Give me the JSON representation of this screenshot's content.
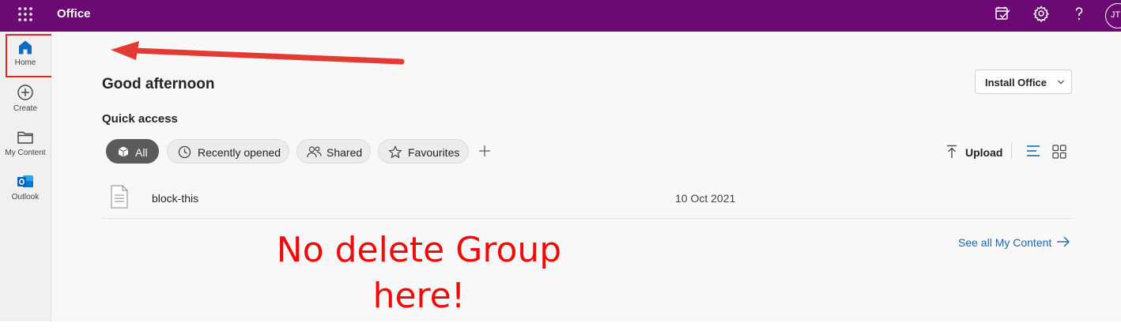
{
  "topbar": {
    "app_name": "Office",
    "avatar_initials": "JT",
    "icons": [
      "waffle-icon",
      "feedback-icon",
      "settings-icon",
      "help-icon"
    ]
  },
  "rail": {
    "items": [
      {
        "label": "Home",
        "icon": "home-icon",
        "active": true
      },
      {
        "label": "Create",
        "icon": "create-icon"
      },
      {
        "label": "My Content",
        "icon": "folder-icon"
      },
      {
        "label": "Outlook",
        "icon": "outlook-icon"
      }
    ]
  },
  "main": {
    "greeting": "Good afternoon",
    "install_label": "Install Office",
    "quick_access_title": "Quick access",
    "filters": [
      {
        "label": "All",
        "icon": "cube-icon",
        "active": true
      },
      {
        "label": "Recently opened",
        "icon": "clock-icon"
      },
      {
        "label": "Shared",
        "icon": "people-icon"
      },
      {
        "label": "Favourites",
        "icon": "star-icon"
      }
    ],
    "upload_label": "Upload",
    "files": [
      {
        "name": "block-this",
        "date": "10 Oct 2021",
        "icon": "document-icon"
      }
    ],
    "see_all_label": "See all My Content"
  },
  "annotation": {
    "line1": "No delete Group",
    "line2": "here!"
  },
  "colors": {
    "topbar": "#6b0a72",
    "accent": "#0f6cbd",
    "annotation": "#f00a0a",
    "active_pill": "#5b5b5b"
  }
}
